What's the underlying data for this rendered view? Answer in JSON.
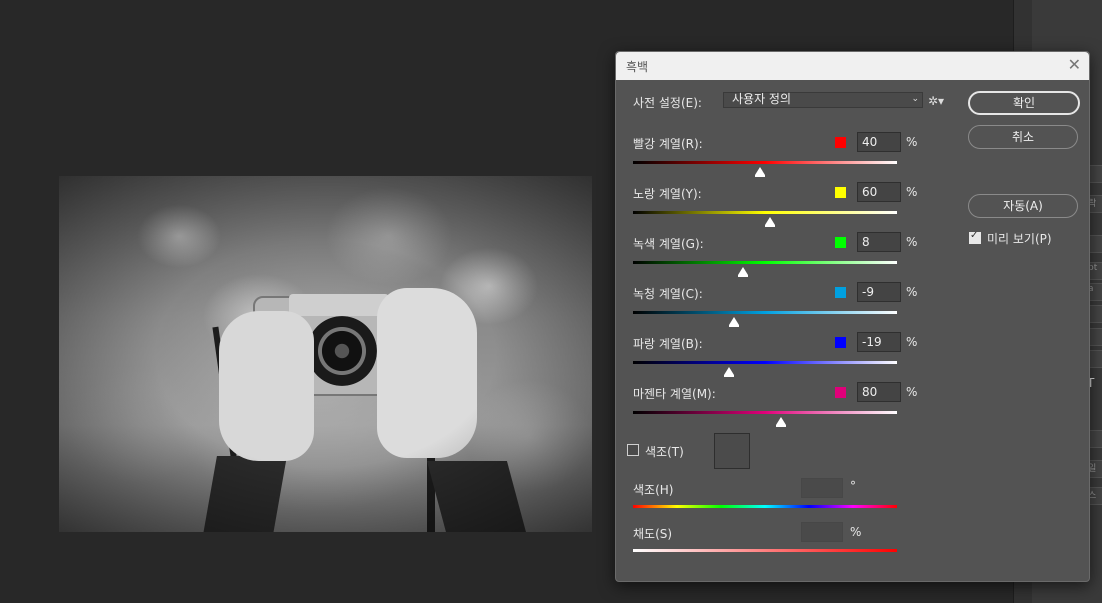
{
  "dialog": {
    "title": "흑백",
    "preset_label": "사전 설정(E):",
    "preset_value": "사용자 정의",
    "channels": [
      {
        "label": "빨강 계열(R):",
        "value": "40",
        "percent": 40,
        "color": "#ff0000"
      },
      {
        "label": "노랑 계열(Y):",
        "value": "60",
        "percent": 60,
        "color": "#ffff00"
      },
      {
        "label": "녹색 계열(G):",
        "value": "8",
        "percent": 8,
        "color": "#00ff00"
      },
      {
        "label": "녹청 계열(C):",
        "value": "-9",
        "percent": -9,
        "color": "#00a0e0"
      },
      {
        "label": "파랑 계열(B):",
        "value": "-19",
        "percent": -19,
        "color": "#0000ff"
      },
      {
        "label": "마젠타 계열(M):",
        "value": "80",
        "percent": 80,
        "color": "#e0007a"
      }
    ],
    "percent_sign": "%",
    "tint_label": "색조(T)",
    "tint_checked": false,
    "hue_label": "색조(H)",
    "hue_unit": "°",
    "saturation_label": "채도(S)",
    "saturation_unit": "%",
    "buttons": {
      "ok": "확인",
      "cancel": "취소",
      "auto": "자동(A)"
    },
    "preview_label": "미리 보기(P)",
    "preview_checked": true
  },
  "side_panel": {
    "fragments": [
      "락",
      "pt",
      "a",
      "T",
      "일",
      "스"
    ]
  }
}
